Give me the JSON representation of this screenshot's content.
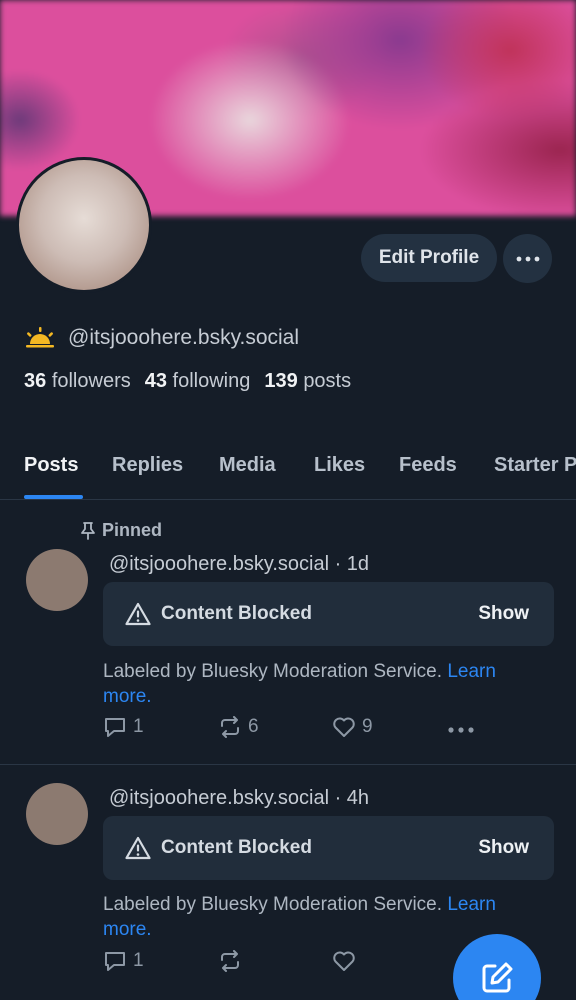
{
  "profile": {
    "handle": "@itsjooohere.bsky.social",
    "followers_count": "36",
    "followers_label": "followers",
    "following_count": "43",
    "following_label": "following",
    "posts_count": "139",
    "posts_label": "posts",
    "edit_profile_label": "Edit Profile"
  },
  "tabs": [
    {
      "label": "Posts",
      "active": true
    },
    {
      "label": "Replies"
    },
    {
      "label": "Media"
    },
    {
      "label": "Likes"
    },
    {
      "label": "Feeds"
    },
    {
      "label": "Starter Packs"
    }
  ],
  "posts": [
    {
      "pinned_label": "Pinned",
      "header": "@itsjooohere.bsky.social · 1d",
      "blocked_label": "Content Blocked",
      "show_label": "Show",
      "note": "Labeled by Bluesky Moderation Service.",
      "note_link": "Learn more.",
      "replies": "1",
      "reposts": "6",
      "likes": "9"
    },
    {
      "header": "@itsjooohere.bsky.social · 4h",
      "blocked_label": "Content Blocked",
      "show_label": "Show",
      "note": "Labeled by Bluesky Moderation Service.",
      "note_link": "Learn more.",
      "replies": "1",
      "reposts": "",
      "likes": ""
    }
  ],
  "colors": {
    "background": "#151d28",
    "accent": "#2c86f2",
    "banner": "#dc4f9d"
  },
  "icons": {
    "status": "sunrise-icon",
    "more": "more-horizontal-icon",
    "pin": "pin-icon",
    "warning": "warning-triangle-icon",
    "reply": "reply-icon",
    "repost": "repost-icon",
    "like": "heart-icon",
    "compose": "compose-icon"
  }
}
